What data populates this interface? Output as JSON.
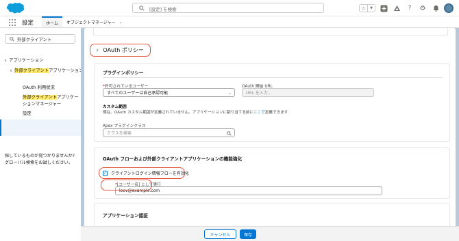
{
  "header": {
    "search_placeholder": "[設定] を検索"
  },
  "app_nav": {
    "app_name": "設定",
    "tabs": [
      {
        "label": "ホーム",
        "active": true
      },
      {
        "label": "オブジェクトマネージャー",
        "active": false
      }
    ]
  },
  "sidebar": {
    "search_value": "外部クライアント",
    "tree": {
      "applications": "アプリケーション",
      "ext_client_prefix": "外部クライアント",
      "ext_client_suffix": "アプリケーション",
      "oauth_status": "OAuth 利用状況",
      "manager_hl": "外部クライアント",
      "manager_rest1": "アプリケー",
      "manager_rest2": "ションマネージャー",
      "settings": "設定"
    },
    "help_line1": "探しているものが見つかりませんか?",
    "help_line2": "グローバル検索をお試しください。"
  },
  "main": {
    "oauth_policy_title": "OAuth ポリシー",
    "plugin_policy": {
      "title": "プラグインポリシー",
      "permitted_users_label": "許可されているユーザー",
      "permitted_users_value": "すべてのユーザーは自己承認可能",
      "start_url_label": "OAuth 開始 URL",
      "start_url_placeholder": "URL を入力...",
      "custom_scope_label": "カスタム範囲",
      "custom_scope_desc_before": "現在、OAuth カスタム範囲が定義されていません。アプリケーションに割り当てる前に",
      "custom_scope_link": "ここで",
      "custom_scope_desc_after": "定義できます",
      "apex_label": "Apex プラグインクラス",
      "apex_placeholder": "クラスを検索"
    },
    "oauth_flows": {
      "title": "OAuth フローおよび外部クライアントアプリケーションの機能強化",
      "checkbox_label": "クライアントログイン情報フローを有効化",
      "checkbox_checked": true,
      "run_as_label": "[ユーザー名] として実行",
      "run_as_value": "loov@example.com"
    },
    "app_auth": {
      "title": "アプリケーション認証"
    }
  },
  "footer": {
    "cancel_label": "キャンセル",
    "save_label": "保存"
  },
  "colors": {
    "brand_blue": "#0176d3",
    "highlight": "#ffe96b",
    "annotation_red": "#e5533d"
  }
}
